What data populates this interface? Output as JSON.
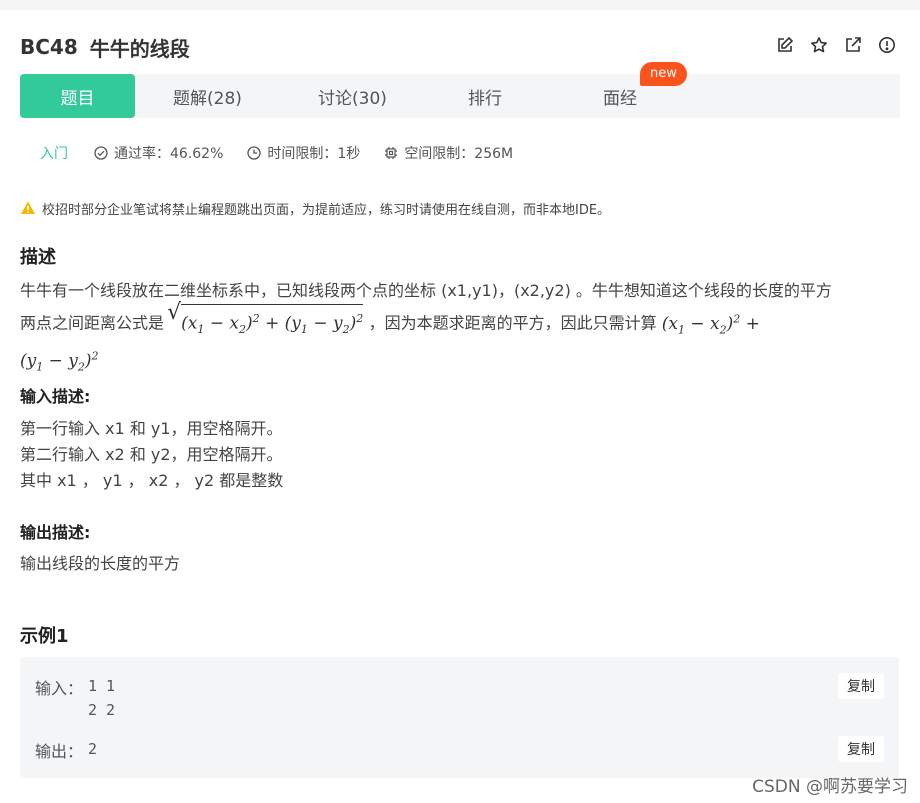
{
  "problem": {
    "code": "BC48",
    "title": "牛牛的线段"
  },
  "toolbar": {
    "icons": [
      "edit-icon",
      "star-icon",
      "share-icon",
      "report-icon"
    ]
  },
  "tabs": [
    {
      "label": "题目",
      "active": true
    },
    {
      "label": "题解(28)"
    },
    {
      "label": "讨论(30)"
    },
    {
      "label": "排行"
    },
    {
      "label": "面经"
    }
  ],
  "new_badge": "new",
  "meta": {
    "level": "入门",
    "pass_rate": "通过率：46.62%",
    "time_limit": "时间限制：1秒",
    "space_limit": "空间限制：256M"
  },
  "warning": "校招时部分企业笔试将禁止编程题跳出页面，为提前适应，练习时请使用在线自测，而非本地IDE。",
  "description": {
    "heading": "描述",
    "line1": "牛牛有一个线段放在二维坐标系中，已知线段两个点的坐标 (x1,y1)，(x2,y2) 。牛牛想知道这个线段的长度的平方",
    "line2_prefix": "两点之间距离公式是",
    "line2_mid": "，因为本题求距离的平方，因此只需计算"
  },
  "input_desc": {
    "heading": "输入描述:",
    "lines": [
      "第一行输入 x1 和 y1，用空格隔开。",
      "第二行输入 x2 和 y2，用空格隔开。",
      "其中 x1 ， y1 ， x2 ， y2 都是整数"
    ]
  },
  "output_desc": {
    "heading": "输出描述:",
    "text": "输出线段的长度的平方"
  },
  "example": {
    "heading": "示例1",
    "input_label": "输入：",
    "input_value": "1 1\n2 2",
    "output_label": "输出：",
    "output_value": "2",
    "copy_label": "复制"
  },
  "watermark": "CSDN @啊苏要学习",
  "colors": {
    "accent": "#32ca99",
    "badge": "#fa541c",
    "warning": "#f5b800"
  }
}
